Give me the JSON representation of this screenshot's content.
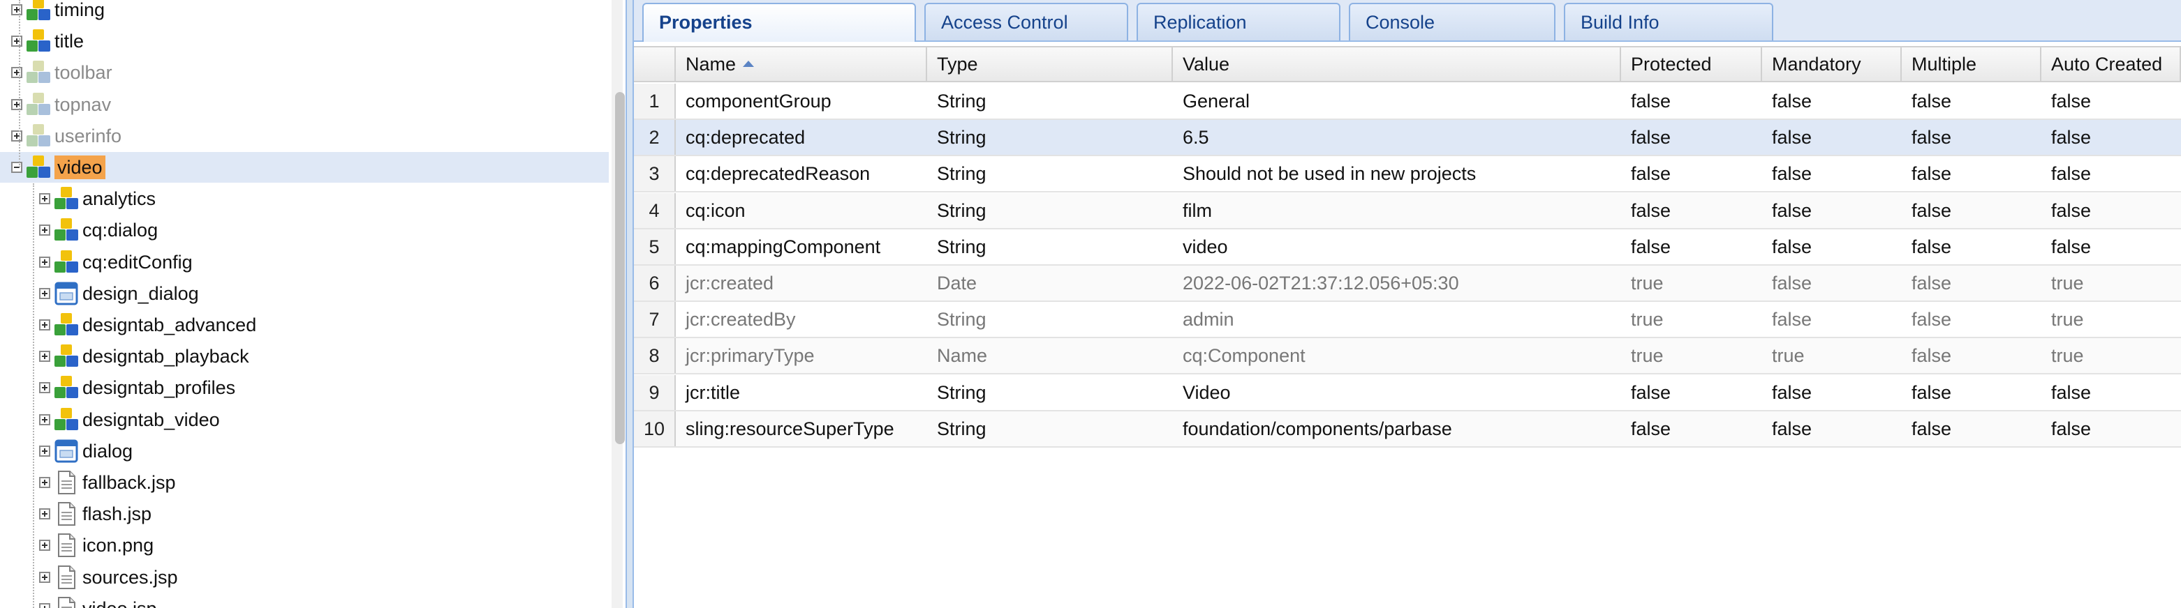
{
  "tree": {
    "items": [
      {
        "label": "timing",
        "level": 0,
        "expanded": false,
        "icon": "node-component-icon",
        "dim": false
      },
      {
        "label": "title",
        "level": 0,
        "expanded": false,
        "icon": "node-component-icon",
        "dim": false
      },
      {
        "label": "toolbar",
        "level": 0,
        "expanded": false,
        "icon": "node-component-dim-icon",
        "dim": true
      },
      {
        "label": "topnav",
        "level": 0,
        "expanded": false,
        "icon": "node-component-dim-icon",
        "dim": true
      },
      {
        "label": "userinfo",
        "level": 0,
        "expanded": false,
        "icon": "node-component-dim-icon",
        "dim": true
      },
      {
        "label": "video",
        "level": 0,
        "expanded": true,
        "icon": "node-component-icon",
        "dim": false,
        "selected": true
      },
      {
        "label": "analytics",
        "level": 1,
        "expanded": false,
        "icon": "node-component-icon",
        "dim": false
      },
      {
        "label": "cq:dialog",
        "level": 1,
        "expanded": false,
        "icon": "node-component-icon",
        "dim": false
      },
      {
        "label": "cq:editConfig",
        "level": 1,
        "expanded": false,
        "icon": "node-component-icon",
        "dim": false
      },
      {
        "label": "design_dialog",
        "level": 1,
        "expanded": false,
        "icon": "dialog-icon",
        "dim": false
      },
      {
        "label": "designtab_advanced",
        "level": 1,
        "expanded": false,
        "icon": "node-component-icon",
        "dim": false
      },
      {
        "label": "designtab_playback",
        "level": 1,
        "expanded": false,
        "icon": "node-component-icon",
        "dim": false
      },
      {
        "label": "designtab_profiles",
        "level": 1,
        "expanded": false,
        "icon": "node-component-icon",
        "dim": false
      },
      {
        "label": "designtab_video",
        "level": 1,
        "expanded": false,
        "icon": "node-component-icon",
        "dim": false
      },
      {
        "label": "dialog",
        "level": 1,
        "expanded": false,
        "icon": "dialog-icon",
        "dim": false
      },
      {
        "label": "fallback.jsp",
        "level": 1,
        "expanded": false,
        "icon": "file-icon",
        "dim": false
      },
      {
        "label": "flash.jsp",
        "level": 1,
        "expanded": false,
        "icon": "file-icon",
        "dim": false
      },
      {
        "label": "icon.png",
        "level": 1,
        "expanded": false,
        "icon": "file-icon",
        "dim": false
      },
      {
        "label": "sources.jsp",
        "level": 1,
        "expanded": false,
        "icon": "file-icon",
        "dim": false
      },
      {
        "label": "video.jsp",
        "level": 1,
        "expanded": false,
        "icon": "file-icon",
        "dim": false
      }
    ]
  },
  "tabs": [
    {
      "label": "Properties",
      "active": true
    },
    {
      "label": "Access Control",
      "active": false
    },
    {
      "label": "Replication",
      "active": false
    },
    {
      "label": "Console",
      "active": false
    },
    {
      "label": "Build Info",
      "active": false
    }
  ],
  "grid": {
    "columns": [
      "Name",
      "Type",
      "Value",
      "Protected",
      "Mandatory",
      "Multiple",
      "Auto Created"
    ],
    "sorted_column": "Name",
    "sort_direction": "ascending",
    "rows": [
      {
        "num": "1",
        "name": "componentGroup",
        "type": "String",
        "value": "General",
        "protected": "false",
        "mandatory": "false",
        "multiple": "false",
        "auto_created": "false"
      },
      {
        "num": "2",
        "name": "cq:deprecated",
        "type": "String",
        "value": "6.5",
        "protected": "false",
        "mandatory": "false",
        "multiple": "false",
        "auto_created": "false",
        "selected": true
      },
      {
        "num": "3",
        "name": "cq:deprecatedReason",
        "type": "String",
        "value": "Should not be used in new projects",
        "protected": "false",
        "mandatory": "false",
        "multiple": "false",
        "auto_created": "false"
      },
      {
        "num": "4",
        "name": "cq:icon",
        "type": "String",
        "value": "film",
        "protected": "false",
        "mandatory": "false",
        "multiple": "false",
        "auto_created": "false"
      },
      {
        "num": "5",
        "name": "cq:mappingComponent",
        "type": "String",
        "value": "video",
        "protected": "false",
        "mandatory": "false",
        "multiple": "false",
        "auto_created": "false"
      },
      {
        "num": "6",
        "name": "jcr:created",
        "type": "Date",
        "value": "2022-06-02T21:37:12.056+05:30",
        "protected": "true",
        "mandatory": "false",
        "multiple": "false",
        "auto_created": "true"
      },
      {
        "num": "7",
        "name": "jcr:createdBy",
        "type": "String",
        "value": "admin",
        "protected": "true",
        "mandatory": "false",
        "multiple": "false",
        "auto_created": "true"
      },
      {
        "num": "8",
        "name": "jcr:primaryType",
        "type": "Name",
        "value": "cq:Component",
        "protected": "true",
        "mandatory": "true",
        "multiple": "false",
        "auto_created": "true"
      },
      {
        "num": "9",
        "name": "jcr:title",
        "type": "String",
        "value": "Video",
        "protected": "false",
        "mandatory": "false",
        "multiple": "false",
        "auto_created": "false"
      },
      {
        "num": "10",
        "name": "sling:resourceSuperType",
        "type": "String",
        "value": "foundation/components/parbase",
        "protected": "false",
        "mandatory": "false",
        "multiple": "false",
        "auto_created": "false"
      }
    ]
  },
  "colors": {
    "selection": "#dfe8f6",
    "highlight": "#f4a34b",
    "tab_text": "#15428b",
    "border": "#99bbe8"
  }
}
